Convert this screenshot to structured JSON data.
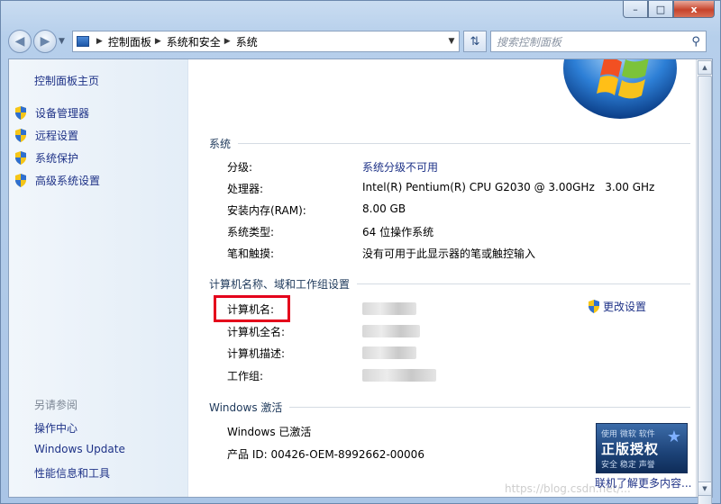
{
  "window": {
    "caption": {
      "minimize": "–",
      "maximize": "□",
      "close": "x"
    }
  },
  "toolbar": {
    "breadcrumb": [
      "控制面板",
      "系统和安全",
      "系统"
    ],
    "search_placeholder": "搜索控制面板"
  },
  "sidebar": {
    "home": "控制面板主页",
    "tasks": [
      "设备管理器",
      "远程设置",
      "系统保护",
      "高级系统设置"
    ],
    "see_also_title": "另请参阅",
    "see_also": [
      "操作中心",
      "Windows Update",
      "性能信息和工具"
    ]
  },
  "system": {
    "title": "系统",
    "rows": [
      {
        "label": "分级:",
        "value": "系统分级不可用",
        "link": true
      },
      {
        "label": "处理器:",
        "value": "Intel(R) Pentium(R) CPU G2030 @ 3.00GHz   3.00 GHz",
        "link": false
      },
      {
        "label": "安装内存(RAM):",
        "value": "8.00 GB",
        "link": false
      },
      {
        "label": "系统类型:",
        "value": "64 位操作系统",
        "link": false
      },
      {
        "label": "笔和触摸:",
        "value": "没有可用于此显示器的笔或触控输入",
        "link": false
      }
    ]
  },
  "computer": {
    "title": "计算机名称、域和工作组设置",
    "rows": [
      {
        "label": "计算机名:"
      },
      {
        "label": "计算机全名:"
      },
      {
        "label": "计算机描述:"
      },
      {
        "label": "工作组:"
      }
    ],
    "change_settings": "更改设置"
  },
  "activation": {
    "title": "Windows 激活",
    "status": "Windows 已激活",
    "product_id": "产品 ID: 00426-OEM-8992662-00006",
    "badge": {
      "line1": "使用 微软 软件",
      "line2": "正版授权",
      "line3": "安全 稳定 声誉"
    },
    "more_link": "联机了解更多内容..."
  },
  "watermark": "https://blog.csdn.net/..."
}
